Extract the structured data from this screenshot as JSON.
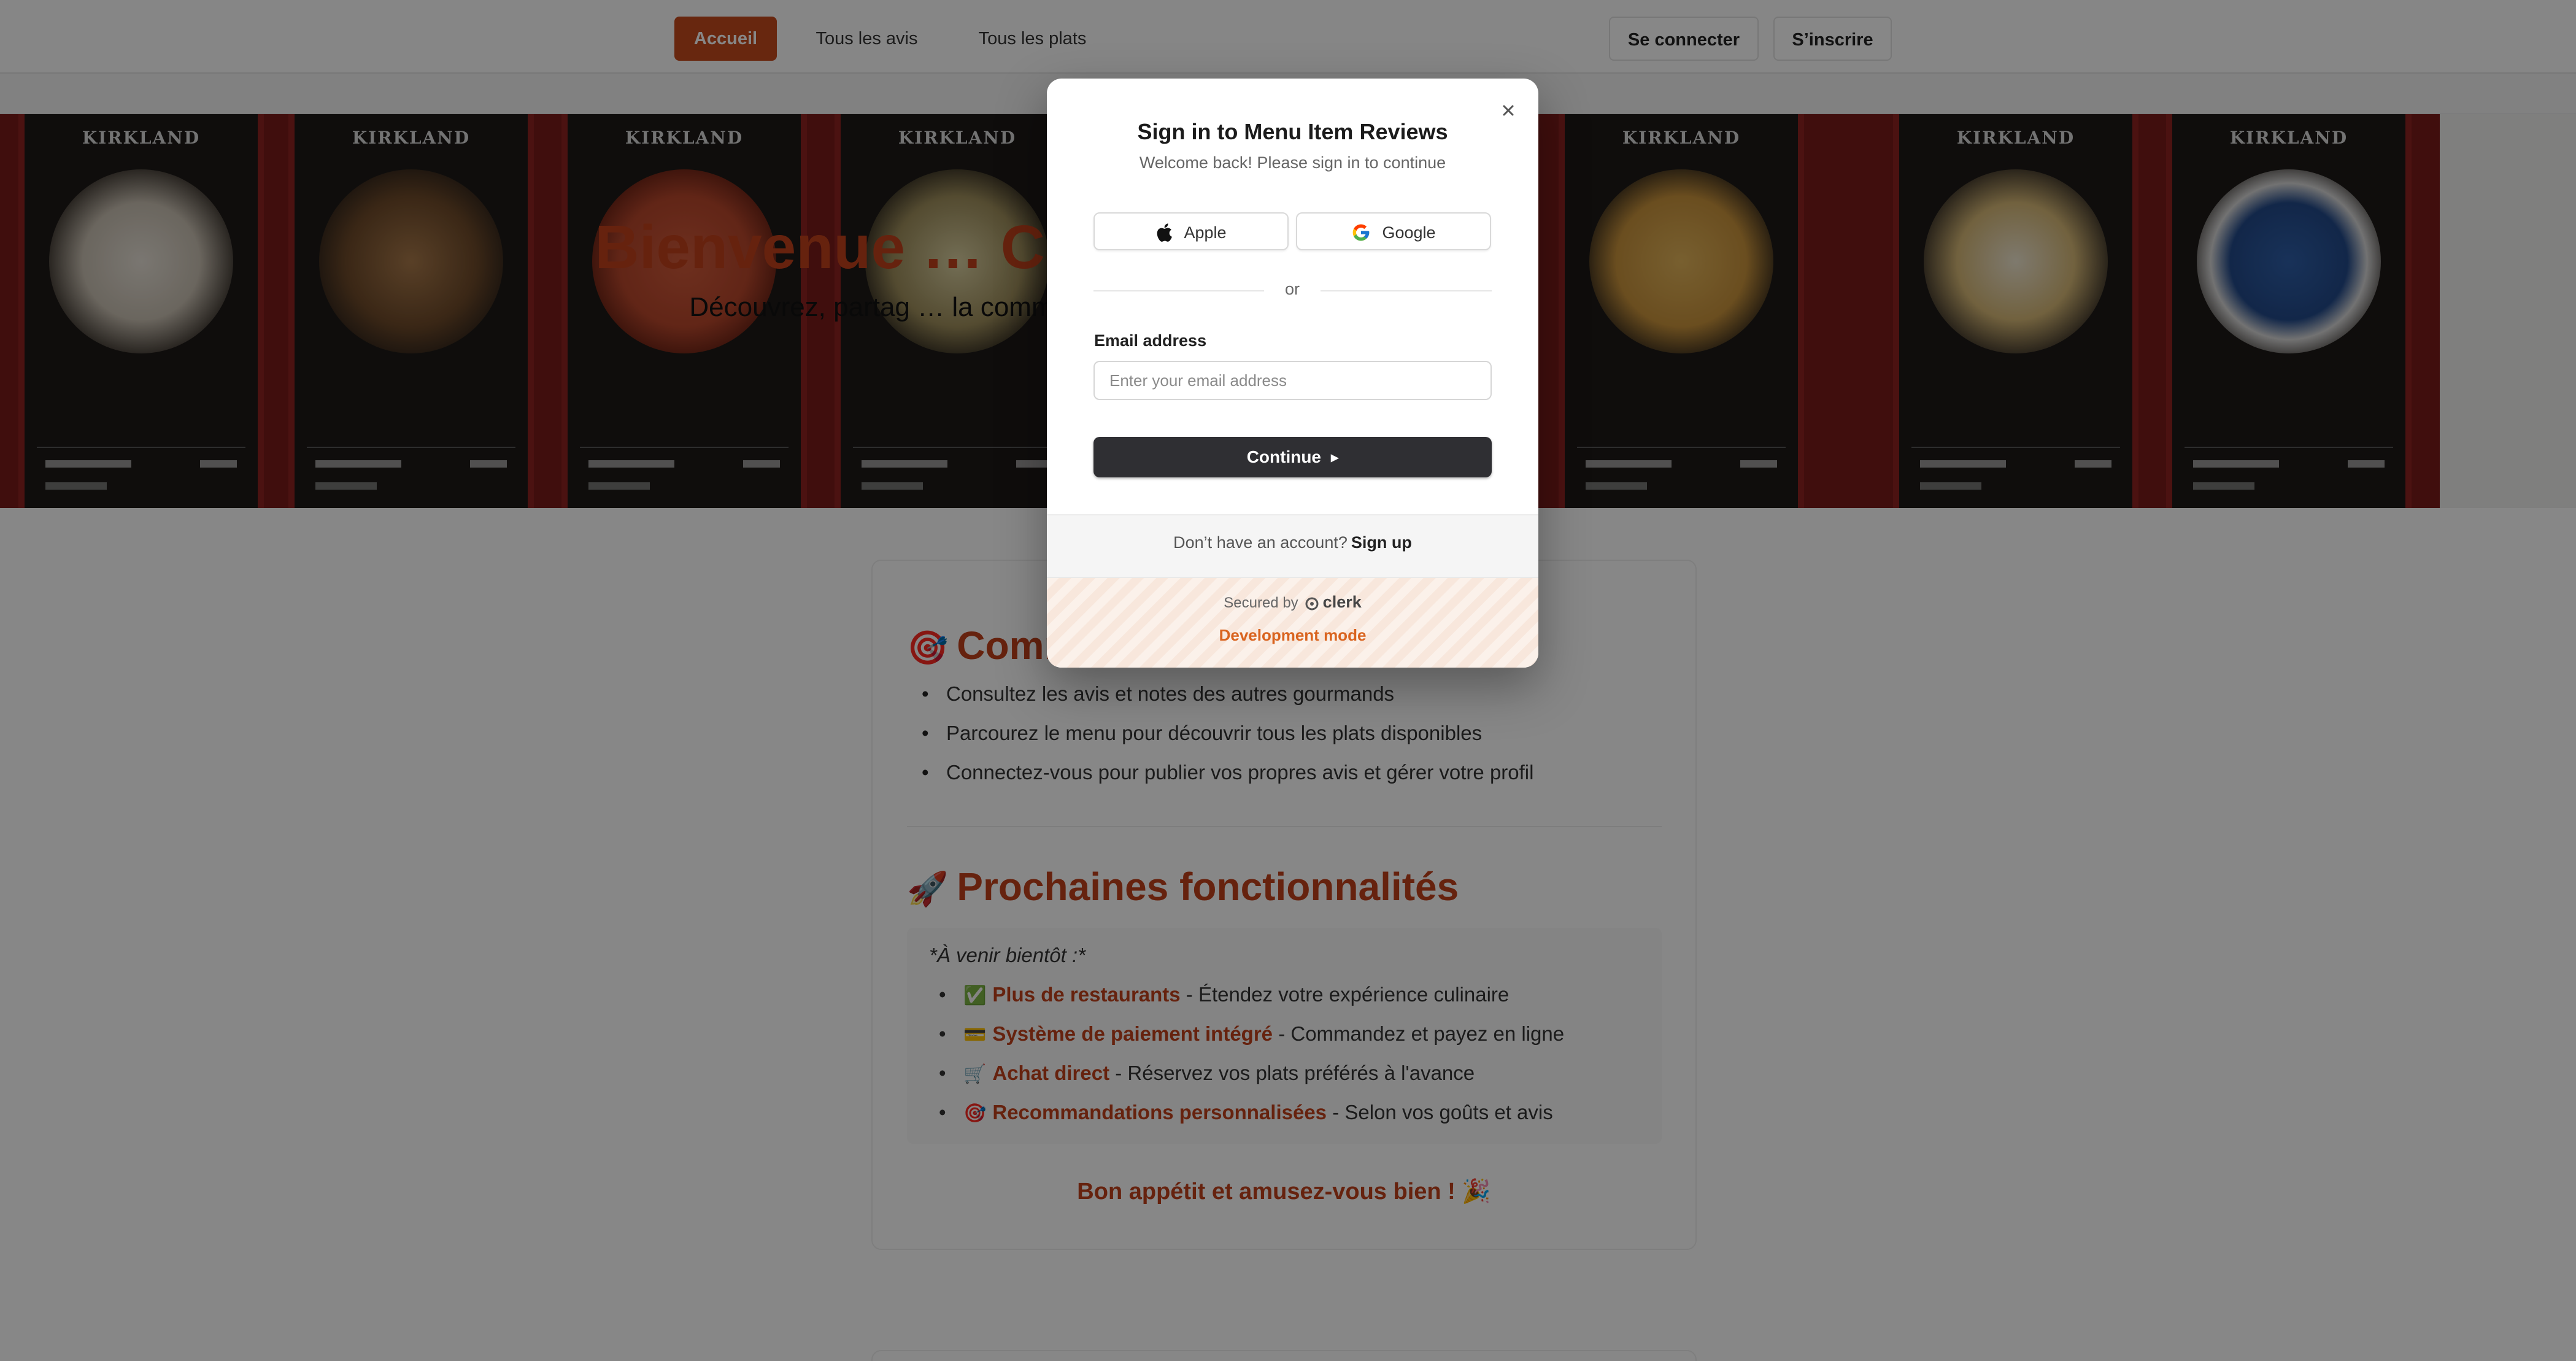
{
  "nav": {
    "home": "Accueil",
    "all_reviews": "Tous les avis",
    "all_dishes": "Tous les plats",
    "login": "Se connecter",
    "signup": "S’inscrire"
  },
  "hero": {
    "brand": "KIRKLAND",
    "title": "Bienvenue … Costco !",
    "subtitle": "Découvrez, partag … la communauté !"
  },
  "section1": {
    "emoji": "🎯",
    "title": "Comm",
    "items": [
      "Consultez les avis et notes des autres gourmands",
      "Parcourez le menu pour découvrir tous les plats disponibles",
      "Connectez-vous pour publier vos propres avis et gérer votre profil"
    ]
  },
  "section2": {
    "emoji": "🚀",
    "title": "Prochaines fonctionnalités",
    "intro": "*À venir bientôt :*",
    "features": [
      {
        "icon": "✅",
        "name": "Plus de restaurants",
        "desc": " - Étendez votre expérience culinaire"
      },
      {
        "icon": "💳",
        "name": "Système de paiement intégré",
        "desc": " - Commandez et payez en ligne"
      },
      {
        "icon": "🛒",
        "name": "Achat direct",
        "desc": " - Réservez vos plats préférés à l'avance"
      },
      {
        "icon": "🎯",
        "name": "Recommandations personnalisées",
        "desc": " - Selon vos goûts et avis"
      }
    ],
    "closing": "Bon appétit et amusez-vous bien ! 🎉"
  },
  "modal": {
    "title": "Sign in to Menu Item Reviews",
    "subtitle": "Welcome back! Please sign in to continue",
    "apple_label": "Apple",
    "google_label": "Google",
    "or": "or",
    "email_label": "Email address",
    "email_placeholder": "Enter your email address",
    "email_value": "",
    "continue_label": "Continue",
    "no_account": "Don’t have an account?",
    "signup_link": "Sign up",
    "secured_by": "Secured by",
    "clerk": "clerk",
    "dev_mode": "Development mode"
  },
  "colors": {
    "accent": "#c0411b",
    "nav_active": "#c44a1e",
    "primary_button": "#2f2f33",
    "dev_mode": "#d9631e"
  }
}
